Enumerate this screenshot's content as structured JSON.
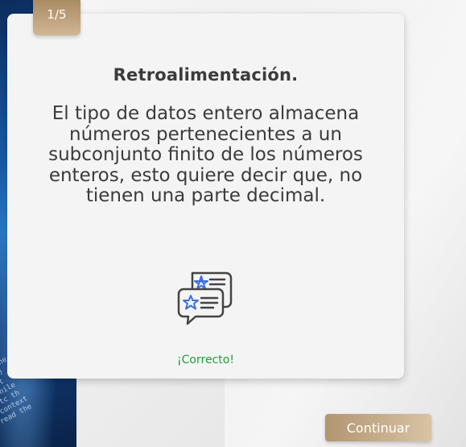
{
  "progress": {
    "label": "1/5"
  },
  "feedback": {
    "title": "Retroalimentación.",
    "message": "El tipo de datos entero almacena números pertenecientes a un subconjunto finito de los números enteros, esto quiere decir que, no tienen una parte decimal.",
    "icon": "chat-bubbles-stars-icon",
    "status": "¡Correcto!",
    "status_color": "#1e9e3a"
  },
  "actions": {
    "continue_label": "Continuar"
  },
  "colors": {
    "accent": "#c4a883",
    "icon_blue": "#3b6fe0",
    "text": "#3b3b3b"
  }
}
